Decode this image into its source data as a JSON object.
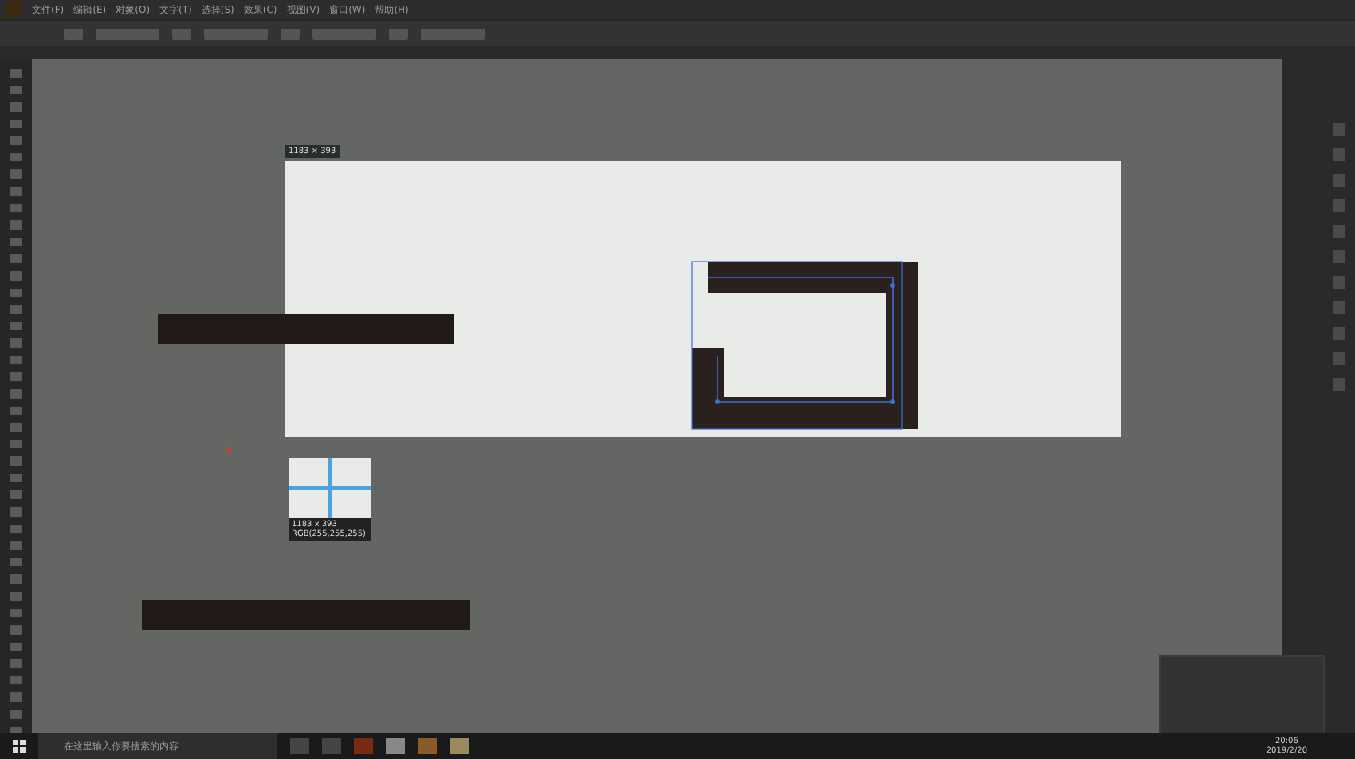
{
  "menu_bar": {
    "items": [
      "文件(F)",
      "编辑(E)",
      "对象(O)",
      "文字(T)",
      "选择(S)",
      "效果(C)",
      "视图(V)",
      "窗口(W)",
      "帮助(H)"
    ]
  },
  "canvas": {
    "artboard_size_label": "1183 × 393",
    "tooltip": {
      "size": "1183 x 393",
      "rgb_reading": "RGB(255,255,255)"
    }
  },
  "taskbar": {
    "search": {
      "placeholder": "在这里输入你要搜索的内容"
    },
    "time": "20:06",
    "date": "2019/2/20"
  }
}
